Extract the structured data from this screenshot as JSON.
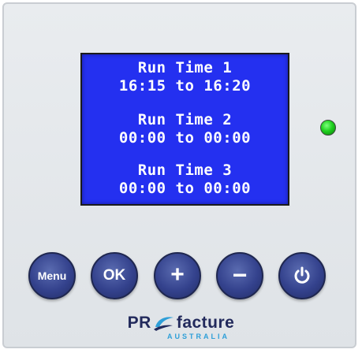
{
  "display": {
    "lines": [
      "Run Time 1",
      "16:15 to 16:20",
      "Run Time 2",
      "00:00 to 00:00",
      "Run Time 3",
      "00:00 to 00:00"
    ],
    "background_color": "#2430f0",
    "text_color": "#ffffff"
  },
  "status_led": {
    "icon": "green-led-indicator",
    "color": "#1fd11f"
  },
  "buttons": {
    "menu_label": "Menu",
    "ok_label": "OK",
    "plus_label": "+",
    "minus_label": "−",
    "power_icon": "power-icon",
    "color": "#34428d"
  },
  "logo": {
    "prefix": "PR",
    "suffix": "facture",
    "sub": "AUSTRALIA",
    "primary_color": "#222a5c",
    "accent_color": "#2e9fd8"
  }
}
